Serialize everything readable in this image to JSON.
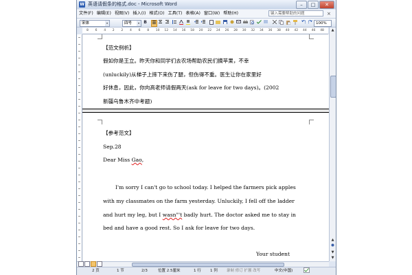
{
  "window": {
    "title": "英语请假条的格式.doc - Microsoft Word",
    "app_icon": "W",
    "minimize_glyph": "–",
    "maximize_glyph": "□",
    "close_glyph": "✕"
  },
  "menu": {
    "items": [
      {
        "label": "文件(F)"
      },
      {
        "label": "编辑(E)"
      },
      {
        "label": "视图(V)"
      },
      {
        "label": "插入(I)"
      },
      {
        "label": "格式(O)"
      },
      {
        "label": "工具(T)"
      },
      {
        "label": "表格(A)"
      },
      {
        "label": "窗口(W)"
      },
      {
        "label": "帮助(H)"
      }
    ],
    "help_placeholder": "键入需要帮助的问题",
    "doc_close_glyph": "×"
  },
  "toolbar": {
    "font_name": "宋体",
    "font_size": "四号",
    "bold": "B",
    "zoom": "100%",
    "combo_arrow": "▾"
  },
  "ruler": {
    "ticks": [
      "8",
      "6",
      "4",
      "2",
      "2",
      "4",
      "6",
      "8",
      "10",
      "12",
      "14",
      "16",
      "18",
      "20",
      "22",
      "24",
      "26",
      "28",
      "30",
      "32",
      "34",
      "36",
      "38",
      "40",
      "42",
      "44",
      "46",
      "48"
    ]
  },
  "document": {
    "page1": {
      "heading": "【范文例析】",
      "lines": [
        "假如你是王立。昨天你和同学们去农场帮助农民们摘苹果，不幸",
        "(unluckily)从梯子上摔下来伤了腿，但伤得不重。医生让你在家里好",
        "好休息，因此，你向高老师请假两天(ask for leave for two days)。(2002",
        "新疆乌鲁木齐中考题)"
      ]
    },
    "page2": {
      "heading": "【参考范文】",
      "date": "Sep.28",
      "salutation_prefix": "Dear Miss ",
      "salutation_name": "Gao",
      "salutation_suffix": ",",
      "body": [
        "I'm sorry I can't go to school today. I helped the farmers pick apples",
        "with my classmates on the farm yesterday. Unluckily, I fell off the ladder"
      ],
      "line3_prefix": "and hurt my leg, but I ",
      "line3_misspelled": "wasn\"'t",
      "line3_suffix": " badly hurt. The doctor asked me to stay in",
      "line4": "bed and have a good rest. So I ask for leave for two days.",
      "closing": "Your student"
    }
  },
  "statusbar": {
    "page": "2 页",
    "section": "1 节",
    "page_of": "2/3",
    "position": "位置 2.5厘米",
    "line": "1 行",
    "column": "1 列",
    "modes": "录制 修订 扩展 改写",
    "language": "中文(中国)"
  },
  "scroll": {
    "up_glyph": "▲",
    "down_glyph": "▼"
  }
}
